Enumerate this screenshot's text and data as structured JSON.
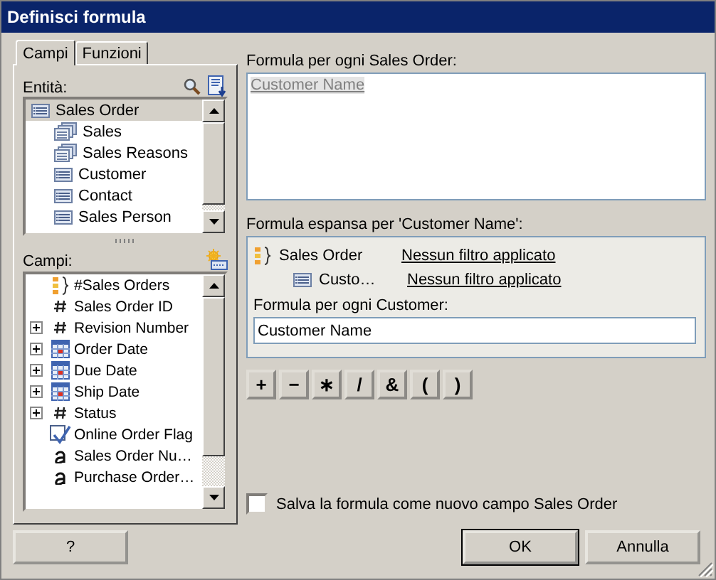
{
  "window": {
    "title": "Definisci formula"
  },
  "tabs": [
    {
      "label": "Campi",
      "selected": true
    },
    {
      "label": "Funzioni",
      "selected": false
    }
  ],
  "entities": {
    "label": "Entità:",
    "items": [
      {
        "label": "Sales Order",
        "kind": "entity",
        "selected": true,
        "children": [
          {
            "label": "Sales",
            "kind": "group",
            "selected": false
          },
          {
            "label": "Sales Reasons",
            "kind": "group",
            "selected": false
          },
          {
            "label": "Customer",
            "kind": "entity",
            "selected": false
          },
          {
            "label": "Contact",
            "kind": "entity",
            "selected": false
          },
          {
            "label": "Sales Person",
            "kind": "entity",
            "selected": false
          }
        ]
      }
    ]
  },
  "fields": {
    "label": "Campi:",
    "items": [
      {
        "label": "#Sales Orders",
        "kind": "aggregate",
        "expandable": false
      },
      {
        "label": "Sales Order ID",
        "kind": "number",
        "expandable": false
      },
      {
        "label": "Revision Number",
        "kind": "number",
        "expandable": true
      },
      {
        "label": "Order Date",
        "kind": "date",
        "expandable": true
      },
      {
        "label": "Due Date",
        "kind": "date",
        "expandable": true
      },
      {
        "label": "Ship Date",
        "kind": "date",
        "expandable": true
      },
      {
        "label": "Status",
        "kind": "number",
        "expandable": true
      },
      {
        "label": "Online Order Flag",
        "kind": "boolean",
        "expandable": false
      },
      {
        "label": "Sales Order Nu…",
        "kind": "text",
        "expandable": false
      },
      {
        "label": "Purchase Order…",
        "kind": "text",
        "expandable": false
      }
    ]
  },
  "formula": {
    "label": "Formula per ogni Sales Order:",
    "value": "Customer Name"
  },
  "expanded": {
    "label": "Formula espansa per 'Customer Name':",
    "rows": [
      {
        "kind": "aggregate",
        "entity": "Sales Order",
        "filter": "Nessun filtro applicato"
      },
      {
        "kind": "entity",
        "entity": "Custo…",
        "filter": "Nessun filtro applicato"
      }
    ],
    "inner_label": "Formula per ogni Customer:",
    "inner_value": "Customer Name"
  },
  "operators": [
    "+",
    "−",
    "∗",
    "/",
    "&",
    "(",
    ")"
  ],
  "save_as_field": {
    "label": "Salva la formula come nuovo campo Sales Order",
    "checked": false
  },
  "buttons": {
    "help": "?",
    "ok": "OK",
    "cancel": "Annulla"
  }
}
